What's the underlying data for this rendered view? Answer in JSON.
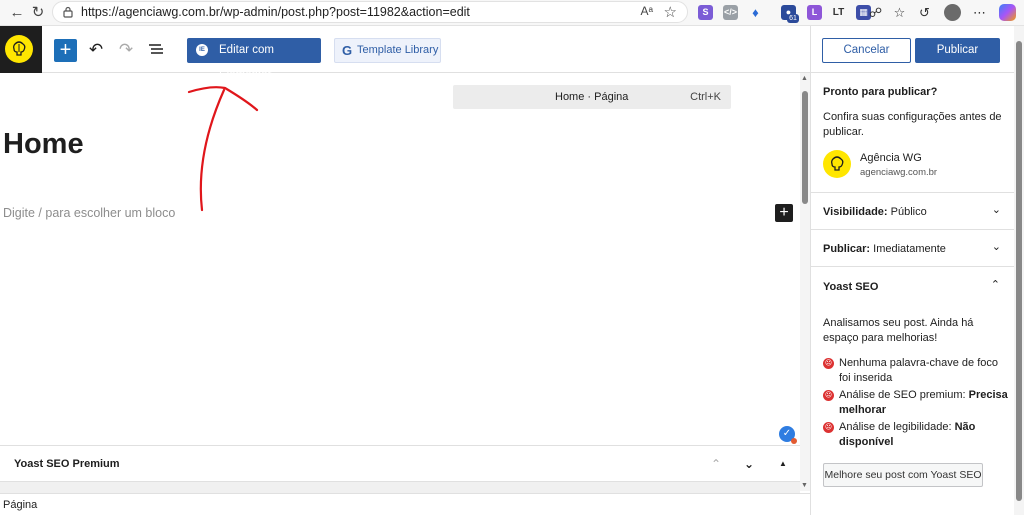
{
  "browser": {
    "url": "https://agenciawg.com.br/wp-admin/post.php?post=11982&action=edit",
    "read_aloud_label": "Aᵃ",
    "ext_badge_count": "61"
  },
  "toolbar": {
    "elementor_label": "Editar com Elementor",
    "template_label": "Template Library"
  },
  "canvas": {
    "command_title": "Home · Página",
    "command_shortcut": "Ctrl+K",
    "page_title": "Home",
    "block_placeholder": "Digite / para escolher um bloco"
  },
  "bottom": {
    "yoast_panel_label": "Yoast SEO Premium",
    "footer_label": "Página"
  },
  "panel": {
    "cancel_label": "Cancelar",
    "publish_label": "Publicar",
    "ready_title": "Pronto para publicar?",
    "ready_desc": "Confira suas configurações antes de publicar.",
    "site_name": "Agência WG",
    "site_url": "agenciawg.com.br",
    "visibility_label": "Visibilidade:",
    "visibility_value": "Público",
    "publish_when_label": "Publicar:",
    "publish_when_value": "Imediatamente",
    "yoast_title": "Yoast SEO",
    "yoast_desc": "Analisamos seu post. Ainda há espaço para melhorias!",
    "issues": [
      {
        "text": "Nenhuma palavra-chave de foco foi inserida",
        "bold": ""
      },
      {
        "text": "Análise de SEO premium: ",
        "bold": "Precisa melhorar"
      },
      {
        "text": "Análise de legibilidade: ",
        "bold": "Não disponível"
      }
    ],
    "improve_label": "Melhore seu post com Yoast SEO"
  },
  "colors": {
    "accent": "#2f5ea6",
    "logo_yellow": "#ffe600",
    "error_red": "#dc3232",
    "annotation_red": "#e0161b"
  }
}
